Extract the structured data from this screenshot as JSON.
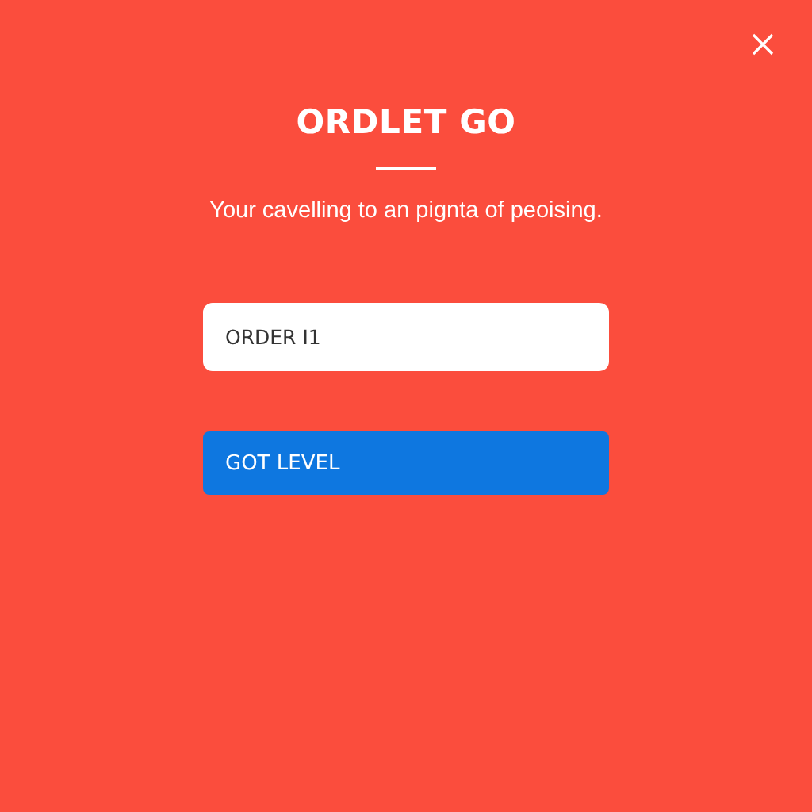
{
  "dialog": {
    "title": "ORDLET GO",
    "message": "Your cavelling to an pignta of peoising.",
    "field": {
      "value": "ORDER I1"
    },
    "button": {
      "label": "GOT LEVEL"
    }
  }
}
